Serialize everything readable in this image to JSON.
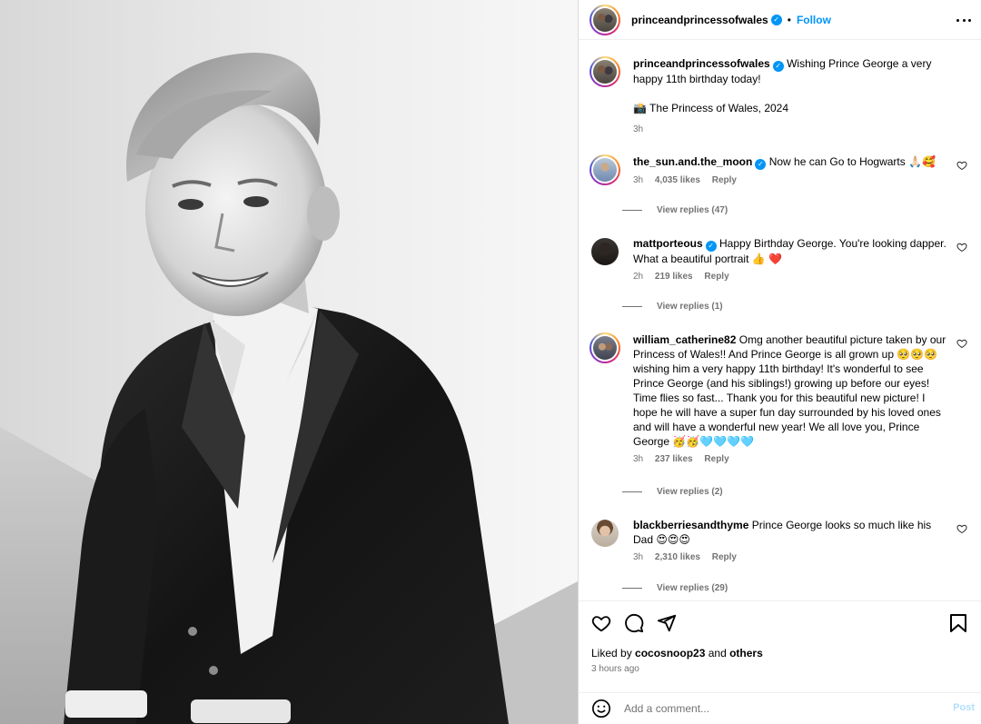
{
  "post": {
    "author": "princeandprincessofwales",
    "follow_label": "Follow",
    "separator": "•"
  },
  "photo": {
    "alt_icon": "portrait-photo"
  },
  "caption": {
    "username": "princeandprincessofwales",
    "text": "Wishing Prince George a very happy 11th birthday today!",
    "credit": "📸 The Princess of Wales, 2024",
    "time": "3h"
  },
  "comments": [
    {
      "username": "the_sun.and.the_moon",
      "verified": true,
      "text": "Now he can Go to Hogwarts 🙏🏻🥰",
      "time": "3h",
      "likes": "4,035 likes",
      "reply": "Reply",
      "view_replies": "View replies (47)"
    },
    {
      "username": "mattporteous",
      "verified": true,
      "text": "Happy Birthday George. You're looking dapper. What a beautiful portrait 👍 ❤️",
      "time": "2h",
      "likes": "219 likes",
      "reply": "Reply",
      "view_replies": "View replies (1)"
    },
    {
      "username": "william_catherine82",
      "verified": false,
      "text": "Omg another beautiful picture taken by our Princess of Wales!! And Prince George is all grown up 🥺🥺🥺 wishing him a very happy 11th birthday! It's wonderful to see Prince George (and his siblings!) growing up before our eyes! Time flies so fast... Thank you for this beautiful new picture! I hope he will have a super fun day surrounded by his loved ones and will have a wonderful new year! We all love you, Prince George 🥳🥳🩵🩵🩵🩵",
      "time": "3h",
      "likes": "237 likes",
      "reply": "Reply",
      "view_replies": "View replies (2)"
    },
    {
      "username": "blackberriesandthyme",
      "verified": false,
      "text": "Prince George looks so much like his Dad 😍😍😍",
      "time": "3h",
      "likes": "2,310 likes",
      "reply": "Reply",
      "view_replies": "View replies (29)"
    }
  ],
  "footer": {
    "liked_by_prefix": "Liked by ",
    "liked_by_user": "cocosnoop23",
    "liked_by_mid": " and ",
    "liked_by_others": "others",
    "posted_ago": "3 hours ago",
    "comment_placeholder": "Add a comment...",
    "post_label": "Post"
  },
  "colors": {
    "accent": "#0095f6",
    "muted": "#737373",
    "post_disabled": "#b2dffc",
    "heart_red": "#ed4956"
  }
}
